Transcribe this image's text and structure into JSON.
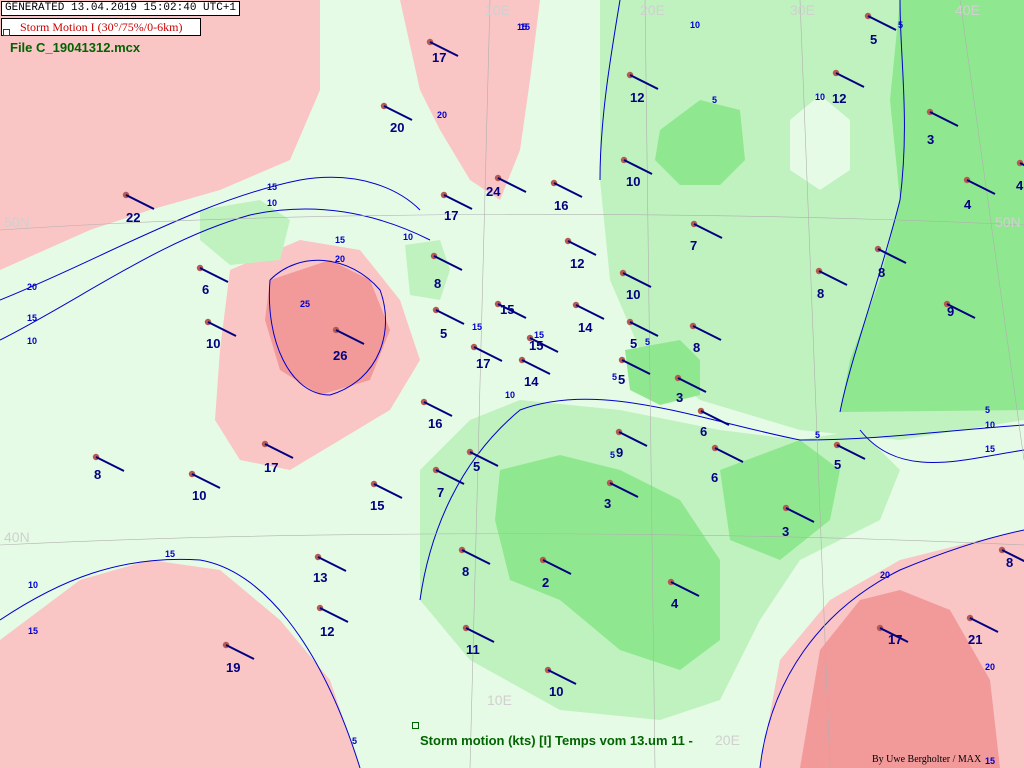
{
  "header": {
    "generated": "GENERATED 13.04.2019 15:02:40 UTC+1",
    "title": "Storm Motion I (30°/75%/0-6km)",
    "file": "File C_19041312.mcx"
  },
  "caption": "Storm motion (kts) [I]  Temps vom 13.um 11 -",
  "credit": "By Uwe Bergholter / MAX",
  "graticule": {
    "lon_labels": [
      "10E",
      "20E",
      "30E",
      "40E",
      "10E",
      "20E"
    ],
    "lat_labels": [
      "50N",
      "40N",
      "50N"
    ]
  },
  "contour_labels": [
    "15",
    "20",
    "20",
    "15",
    "10",
    "15",
    "10",
    "15",
    "20",
    "25",
    "10",
    "15",
    "15",
    "10",
    "5",
    "5",
    "5",
    "10",
    "15",
    "5",
    "5",
    "10",
    "15",
    "20",
    "5",
    "15",
    "20",
    "10",
    "15",
    "5",
    "5",
    "10",
    "15"
  ],
  "stations": [
    {
      "v": "17"
    },
    {
      "v": "20"
    },
    {
      "v": "24"
    },
    {
      "v": "17"
    },
    {
      "v": "22"
    },
    {
      "v": "6"
    },
    {
      "v": "10"
    },
    {
      "v": "26"
    },
    {
      "v": "8"
    },
    {
      "v": "5"
    },
    {
      "v": "15"
    },
    {
      "v": "17"
    },
    {
      "v": "15"
    },
    {
      "v": "16"
    },
    {
      "v": "10"
    },
    {
      "v": "17"
    },
    {
      "v": "8"
    },
    {
      "v": "15"
    },
    {
      "v": "7"
    },
    {
      "v": "5"
    },
    {
      "v": "13"
    },
    {
      "v": "12"
    },
    {
      "v": "19"
    },
    {
      "v": "8"
    },
    {
      "v": "11"
    },
    {
      "v": "10"
    },
    {
      "v": "2"
    },
    {
      "v": "4"
    },
    {
      "v": "3"
    },
    {
      "v": "9"
    },
    {
      "v": "14"
    },
    {
      "v": "14"
    },
    {
      "v": "12"
    },
    {
      "v": "16"
    },
    {
      "v": "10"
    },
    {
      "v": "7"
    },
    {
      "v": "5"
    },
    {
      "v": "5"
    },
    {
      "v": "3"
    },
    {
      "v": "8"
    },
    {
      "v": "6"
    },
    {
      "v": "6"
    },
    {
      "v": "3"
    },
    {
      "v": "5"
    },
    {
      "v": "12"
    },
    {
      "v": "10"
    },
    {
      "v": "8"
    },
    {
      "v": "8"
    },
    {
      "v": "12"
    },
    {
      "v": "3"
    },
    {
      "v": "4"
    },
    {
      "v": "4"
    },
    {
      "v": "5"
    },
    {
      "v": "9"
    },
    {
      "v": "8"
    },
    {
      "v": "17"
    },
    {
      "v": "21"
    },
    {
      "v": "20"
    }
  ],
  "colors": {
    "red_zone": "#f9c5c5",
    "red_dark": "#f29a9a",
    "light_green": "#e6fbe6",
    "mid_green": "#bff2bf",
    "dark_green": "#8fe88f",
    "contour": "#0000cc",
    "barb": "#000080",
    "station_dot": "#b45a50"
  }
}
